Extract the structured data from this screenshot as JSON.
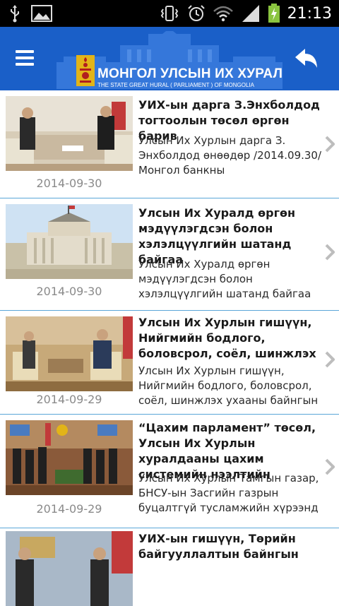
{
  "status_bar": {
    "time": "21:13",
    "icons": [
      "usb-icon",
      "image-icon",
      "vibrate-icon",
      "alarm-icon",
      "wifi-icon",
      "signal-icon",
      "battery-charging-icon"
    ]
  },
  "header": {
    "title": "МОНГОЛ УЛСЫН ИХ ХУРАЛ",
    "subtitle": "THE STATE GREAT HURAL ( PARLIAMENT ) OF MONGOLIA",
    "menu_icon": "menu-icon",
    "back_icon": "back-icon",
    "color": "#1a5fc8"
  },
  "news": [
    {
      "title": "УИХ-ын дарга З.Энхболдод тогтоолын төсөл өргөн барив",
      "snippet": "  Улсын Их Хурлын дарга З. Энхболдод өнөөдөр /2014.09.30/ Монгол банкны",
      "date": "2014-09-30"
    },
    {
      "title": "Улсын Их Хуралд өргөн мэдүүлэгдсэн болон хэлэлцүүлгийн шатанд байгаа",
      "snippet": "  Улсын Их Хуралд өргөн мэдүүлэгдсэн болон хэлэлцүүлгийн шатанд байгаа",
      "date": "2014-09-30"
    },
    {
      "title": "Улсын Их Хурлын гишүүн, Нийгмийн бодлого, боловсрол, соёл, шинжлэх",
      "snippet": "Улсын Их Хурлын гишүүн, Нийгмийн бодлого, боловсрол, соёл, шинжлэх ухааны байнгын",
      "date": "2014-09-29"
    },
    {
      "title": "“Цахим парламент” төсөл, Улсын Их Хурлын хуралдааны цахим системийн нээлтийн",
      "snippet": "Улсын Их Хурлын Тамгын газар, БНСУ-ын Засгийн газрын буцалтгүй тусламжийн хүрээнд",
      "date": "2014-09-29"
    },
    {
      "title": "УИХ-ын гишүүн, Төрийн байгууллалтын байнгын",
      "snippet": "",
      "date": ""
    }
  ]
}
